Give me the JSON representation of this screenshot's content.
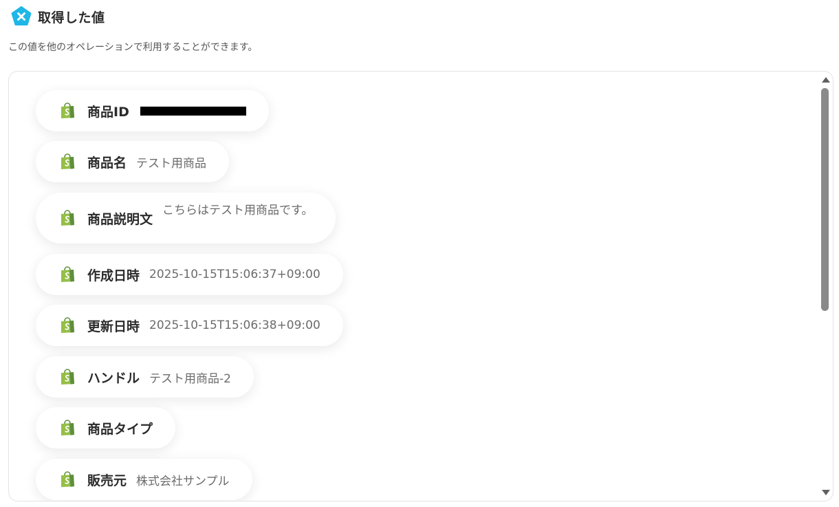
{
  "header": {
    "title": "取得した値",
    "subtitle": "この値を他のオペレーションで利用することができます。",
    "logo_icon": "yoom-pentagon-x-icon",
    "logo_color": "#1fb7e8"
  },
  "fields": [
    {
      "label": "商品ID",
      "value": "",
      "redacted": true
    },
    {
      "label": "商品名",
      "value": "テスト用商品"
    },
    {
      "label": "商品説明文",
      "value": "こちらはテスト用商品です。"
    },
    {
      "label": "作成日時",
      "value": "2025-10-15T15:06:37+09:00"
    },
    {
      "label": "更新日時",
      "value": "2025-10-15T15:06:38+09:00"
    },
    {
      "label": "ハンドル",
      "value": "テスト用商品-2"
    },
    {
      "label": "商品タイプ",
      "value": ""
    },
    {
      "label": "販売元",
      "value": "株式会社サンプル"
    }
  ],
  "field_icon": "shopify-bag-icon",
  "colors": {
    "shopify_green": "#95bf47",
    "shopify_dark": "#5e8e3e"
  }
}
